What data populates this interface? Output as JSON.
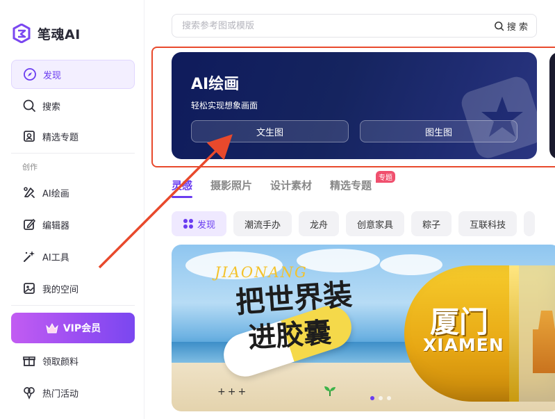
{
  "brand": {
    "name": "笔魂AI"
  },
  "search": {
    "placeholder": "搜索参考图或模版",
    "button_label": "搜 索"
  },
  "sidebar": {
    "items_top": [
      {
        "label": "发现",
        "icon": "discover-icon",
        "active": true
      },
      {
        "label": "搜索",
        "icon": "search-icon"
      },
      {
        "label": "精选专题",
        "icon": "featured-icon"
      }
    ],
    "section_label": "创作",
    "items_create": [
      {
        "label": "AI绘画",
        "icon": "ai-paint-icon"
      },
      {
        "label": "编辑器",
        "icon": "editor-icon"
      },
      {
        "label": "AI工具",
        "icon": "ai-tools-icon"
      },
      {
        "label": "我的空间",
        "icon": "my-space-icon"
      }
    ],
    "vip_label": "VIP会员",
    "items_bottom": [
      {
        "label": "领取颜料",
        "icon": "gift-icon"
      },
      {
        "label": "热门活动",
        "icon": "balloon-icon"
      }
    ]
  },
  "banner": {
    "title": "AI绘画",
    "subtitle": "轻松实现想象画面",
    "buttons": [
      "文生图",
      "图生图"
    ]
  },
  "tabs": {
    "items": [
      "灵感",
      "摄影照片",
      "设计素材",
      "精选专题"
    ],
    "active_index": 0,
    "badge": "专题"
  },
  "chips": {
    "items": [
      "发现",
      "潮流手办",
      "龙舟",
      "创意家具",
      "粽子",
      "互联科技"
    ],
    "active_index": 0
  },
  "poster": {
    "pinyin": "JIAONANG",
    "headline_line1": "把世界装",
    "headline_line2": "进胶囊",
    "capsule_text_cn": "厦门",
    "capsule_text_en": "XIAMEN",
    "stars": "+++",
    "carousel_index": 0,
    "carousel_count": 3
  },
  "colors": {
    "accent": "#6a3cf0",
    "banner_bg": "#15245f",
    "highlight": "#e8492c",
    "vip_gradient_start": "#c25cf2",
    "vip_gradient_end": "#7a47f0"
  }
}
